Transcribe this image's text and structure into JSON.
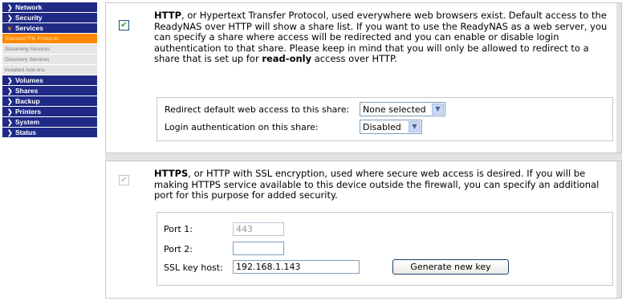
{
  "sidebar": {
    "top_items": [
      {
        "label": "Network"
      },
      {
        "label": "Security"
      },
      {
        "label": "Services"
      }
    ],
    "sub_items": [
      {
        "label": "Standard File Protocols",
        "active": true
      },
      {
        "label": "Streaming Services",
        "active": false
      },
      {
        "label": "Discovery Services",
        "active": false
      },
      {
        "label": "Installed Add-ons",
        "active": false
      }
    ],
    "bottom_items": [
      {
        "label": "Volumes"
      },
      {
        "label": "Shares"
      },
      {
        "label": "Backup"
      },
      {
        "label": "Printers"
      },
      {
        "label": "System"
      },
      {
        "label": "Status"
      }
    ]
  },
  "http": {
    "checked": true,
    "title": "HTTP",
    "desc_part1": ", or Hypertext Transfer Protocol, used everywhere web browsers exist. Default access to the ReadyNAS over HTTP will show a share list. If you want to use the ReadyNAS as a web server, you can specify a share where access will be redirected and you can enable or disable login authentication to that share. Please keep in mind that you will only be allowed to redirect to a share that is set up for ",
    "desc_bold": "read-only",
    "desc_part2": " access over HTTP.",
    "redirect_label": "Redirect default web access to this share:",
    "redirect_value": "None selected",
    "login_label": "Login authentication on this share:",
    "login_value": "Disabled"
  },
  "https": {
    "checked": true,
    "title": "HTTPS",
    "desc": ", or HTTP with SSL encryption, used where secure web access is desired. If you will be making HTTPS service available to this device outside the firewall, you can specify an additional port for this purpose for added security.",
    "port1_label": "Port 1:",
    "port1_value": "443",
    "port2_label": "Port 2:",
    "port2_value": "",
    "ssl_label": "SSL key host:",
    "ssl_value": "192.168.1.143",
    "generate_label": "Generate new key"
  },
  "icons": {
    "chevron": "chevron-right-icon",
    "chevron_open": "chevron-down-icon",
    "check": "checkmark-icon",
    "dropdown": "dropdown-arrow-icon"
  },
  "colors": {
    "nav_bg": "#1f2a86",
    "nav_active_bg": "#ff8800",
    "nav_open_chevron": "#ff9a20",
    "check_green": "#21a121"
  }
}
